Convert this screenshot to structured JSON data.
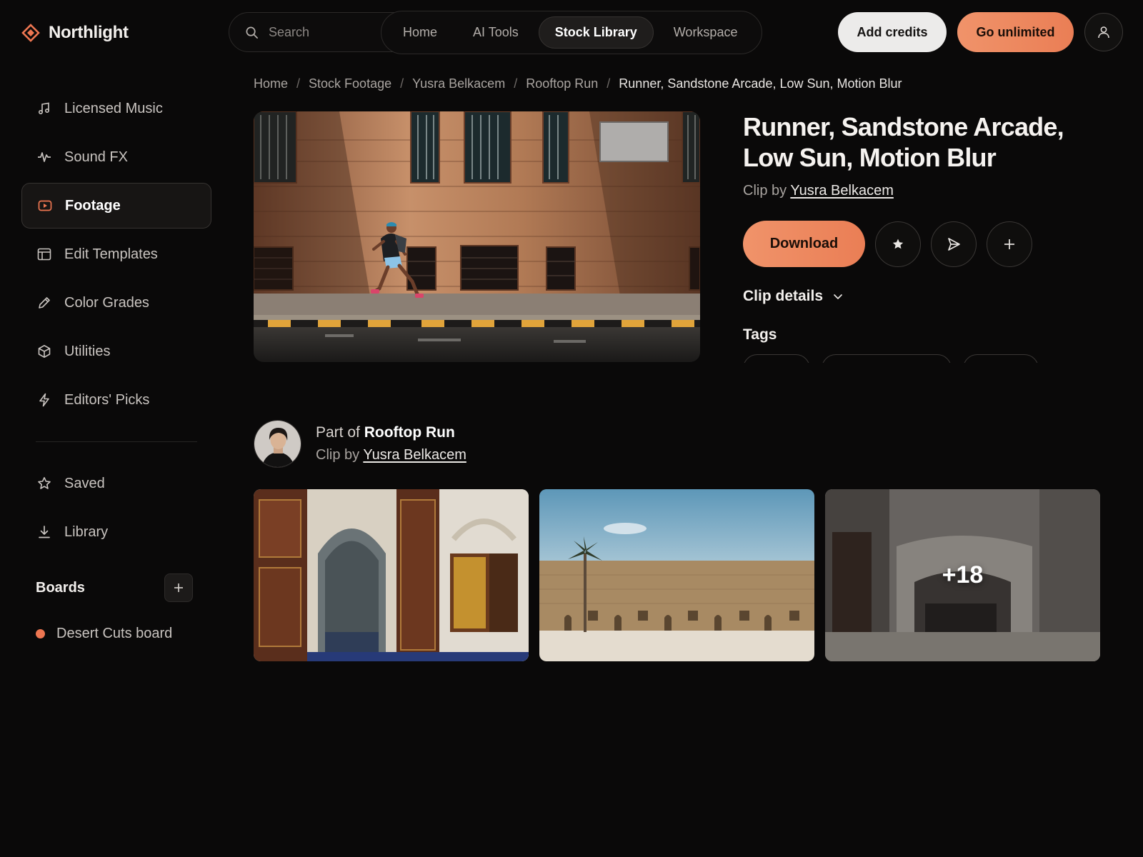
{
  "brand": {
    "name": "Northlight",
    "accent": "#ee7651"
  },
  "search": {
    "placeholder": "Search"
  },
  "nav": {
    "items": [
      {
        "label": "Home"
      },
      {
        "label": "AI Tools"
      },
      {
        "label": "Stock Library",
        "active": true
      },
      {
        "label": "Workspace"
      }
    ]
  },
  "header": {
    "add_credits": "Add credits",
    "go_unlimited": "Go unlimited"
  },
  "sidebar": {
    "items": [
      {
        "label": "Licensed Music",
        "icon": "music-note-icon"
      },
      {
        "label": "Sound FX",
        "icon": "waveform-icon"
      },
      {
        "label": "Footage",
        "icon": "play-video-icon",
        "active": true
      },
      {
        "label": "Edit Templates",
        "icon": "template-icon"
      },
      {
        "label": "Color Grades",
        "icon": "pencil-icon"
      },
      {
        "label": "Utilities",
        "icon": "cube-icon"
      },
      {
        "label": "Editors' Picks",
        "icon": "lightning-icon"
      }
    ],
    "secondary": [
      {
        "label": "Saved",
        "icon": "star-icon"
      },
      {
        "label": "Library",
        "icon": "download-icon"
      }
    ],
    "boards": {
      "title": "Boards",
      "items": [
        {
          "label": "Desert Cuts board",
          "color": "#ee7651"
        }
      ]
    }
  },
  "breadcrumb": {
    "items": [
      "Home",
      "Stock Footage",
      "Yusra Belkacem",
      "Rooftop Run"
    ],
    "current": "Runner, Sandstone Arcade, Low Sun, Motion Blur"
  },
  "clip": {
    "title": "Runner, Sandstone Arcade, Low Sun, Motion Blur",
    "by_prefix": "Clip by",
    "author": "Yusra Belkacem",
    "download_label": "Download",
    "details_label": "Clip details",
    "tags_label": "Tags"
  },
  "collection": {
    "part_prefix": "Part of",
    "name": "Rooftop Run",
    "by_prefix": "Clip by",
    "author": "Yusra Belkacem",
    "more_count": "+18"
  }
}
